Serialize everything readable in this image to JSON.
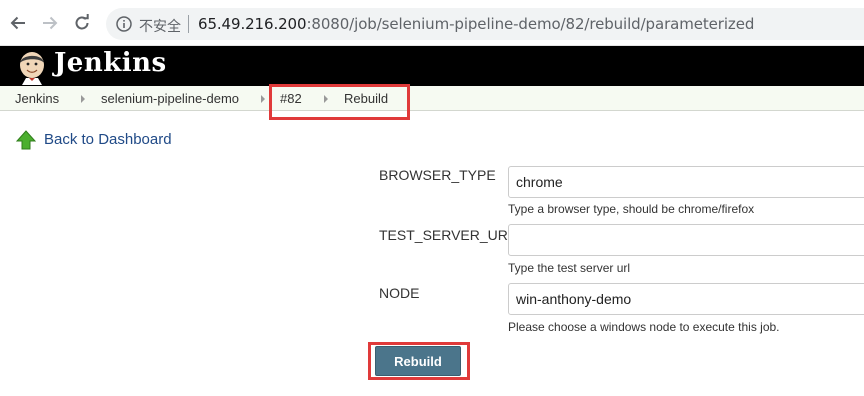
{
  "browser": {
    "security_label": "不安全",
    "url_host": "65.49.216.200",
    "url_rest": ":8080/job/selenium-pipeline-demo/82/rebuild/parameterized"
  },
  "header": {
    "title": "Jenkins",
    "logo_icon": "jenkins-butler-logo"
  },
  "breadcrumb": {
    "items": [
      {
        "label": "Jenkins"
      },
      {
        "label": "selenium-pipeline-demo"
      },
      {
        "label": "#82"
      },
      {
        "label": "Rebuild"
      }
    ]
  },
  "sidebar": {
    "back_label": "Back to Dashboard",
    "back_icon": "green-up-arrow-icon"
  },
  "form": {
    "params": [
      {
        "name": "BROWSER_TYPE",
        "value": "chrome",
        "description": "Type a browser type, should be chrome/firefox"
      },
      {
        "name": "TEST_SERVER_URL",
        "value": "",
        "description": "Type the test server url"
      },
      {
        "name": "NODE",
        "value": "win-anthony-demo",
        "description": "Please choose a windows node to execute this job."
      }
    ],
    "submit_label": "Rebuild"
  },
  "colors": {
    "header_bg": "#000000",
    "breadcrumb_bg": "#f6faf2",
    "button_bg": "#4b758b",
    "highlight": "#e03a3a"
  }
}
